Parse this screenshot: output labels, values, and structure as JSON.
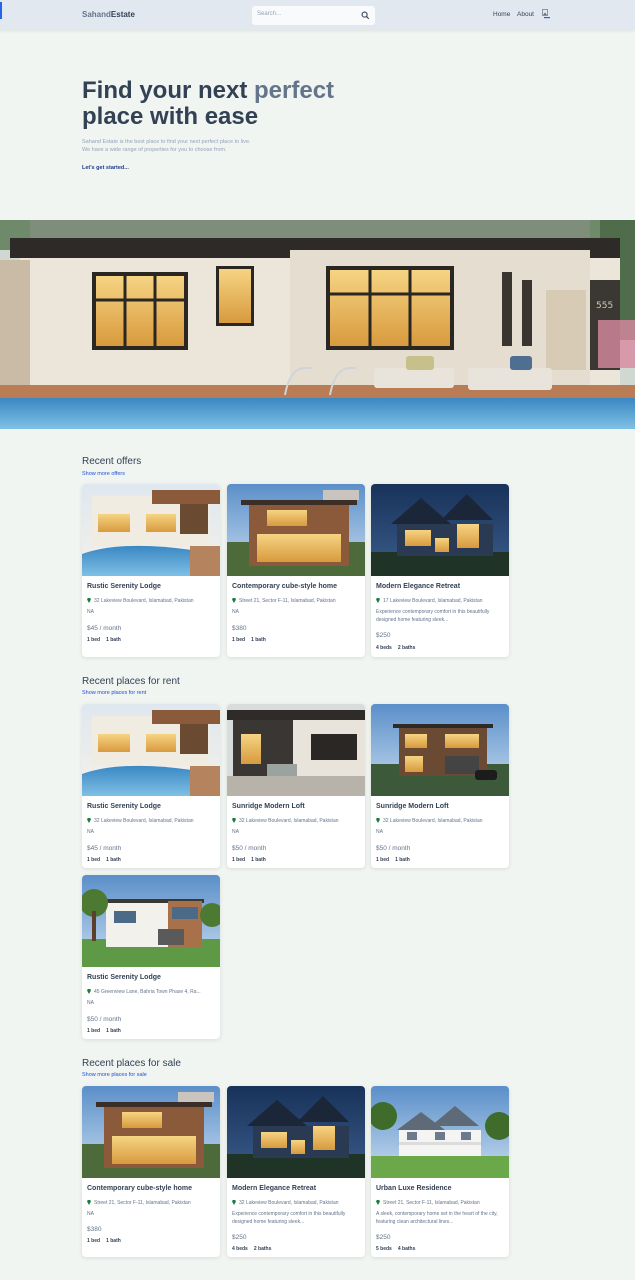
{
  "header": {
    "logo_part1": "Sahand",
    "logo_part2": "Estate",
    "search_placeholder": "Search...",
    "nav_home": "Home",
    "nav_about": "About"
  },
  "hero": {
    "title_line1a": "Find your next ",
    "title_line1b": "perfect",
    "title_line2": "place with ease",
    "subtitle_line1": "Sahand Estate is the best place to find your next perfect place to live.",
    "subtitle_line2": "We have a wide range of properties for you to choose from.",
    "cta": "Let's get started...",
    "house_number": "555"
  },
  "offers": {
    "title": "Recent offers",
    "link": "Show more offers",
    "cards": [
      {
        "name": "Rustic Serenity Lodge",
        "address": "32 Lakeview Boulevard, Islamabad, Pakistan",
        "desc": "NA",
        "price": "$45 / month",
        "beds": "1 bed",
        "baths": "1 bath"
      },
      {
        "name": "Contemporary cube-style home",
        "address": "Street 21, Sector F-11, Islamabad, Pakistan",
        "desc": "NA",
        "price": "$380",
        "beds": "1 bed",
        "baths": "1 bath"
      },
      {
        "name": "Modern Elegance Retreat",
        "address": "17 Lakeview Boulevard, Islamabad, Pakistan",
        "desc": "Experience contemporary comfort in this beautifully designed home featuring sleek...",
        "price": "$250",
        "beds": "4 beds",
        "baths": "2 baths"
      }
    ]
  },
  "rent": {
    "title": "Recent places for rent",
    "link": "Show more places for rent",
    "cards": [
      {
        "name": "Rustic Serenity Lodge",
        "address": "32 Lakeview Boulevard, Islamabad, Pakistan",
        "desc": "NA",
        "price": "$45 / month",
        "beds": "1 bed",
        "baths": "1 bath"
      },
      {
        "name": "Sunridge Modern Loft",
        "address": "32 Lakeview Boulevard, Islamabad, Pakistan",
        "desc": "NA",
        "price": "$50 / month",
        "beds": "1 bed",
        "baths": "1 bath"
      },
      {
        "name": "Sunridge Modern Loft",
        "address": "32 Lakeview Boulevard, Islamabad, Pakistan",
        "desc": "NA",
        "price": "$50 / month",
        "beds": "1 bed",
        "baths": "1 bath"
      },
      {
        "name": "Rustic Serenity Lodge",
        "address": "45 Greenview Lane, Bahria Town Phase 4, Ra...",
        "desc": "NA",
        "price": "$50 / month",
        "beds": "1 bed",
        "baths": "1 bath"
      }
    ]
  },
  "sale": {
    "title": "Recent places for sale",
    "link": "Show more places for sale",
    "cards": [
      {
        "name": "Contemporary cube-style home",
        "address": "Street 21, Sector F-11, Islamabad, Pakistan",
        "desc": "NA",
        "price": "$380",
        "beds": "1 bed",
        "baths": "1 bath"
      },
      {
        "name": "Modern Elegance Retreat",
        "address": "32 Lakeview Boulevard, Islamabad, Pakistan",
        "desc": "Experience contemporary comfort in this beautifully designed home featuring sleek...",
        "price": "$250",
        "beds": "4 beds",
        "baths": "2 baths"
      },
      {
        "name": "Urban Luxe Residence",
        "address": "Street 21, Sector F-11, Islamabad, Pakistan",
        "desc": "A sleek, contemporary home set in the heart of the city, featuring clean architectural lines...",
        "price": "$250",
        "beds": "5 beds",
        "baths": "4 baths"
      }
    ]
  },
  "icons": {
    "search": "search-icon",
    "pin": "location-pin-icon",
    "avatar": "user-avatar-icon"
  },
  "colors": {
    "accent": "#2563eb",
    "link": "#1d4ed8",
    "pin": "#15803d",
    "page_bg": "#f1f5f1",
    "header_bg": "#e2e8f0"
  }
}
